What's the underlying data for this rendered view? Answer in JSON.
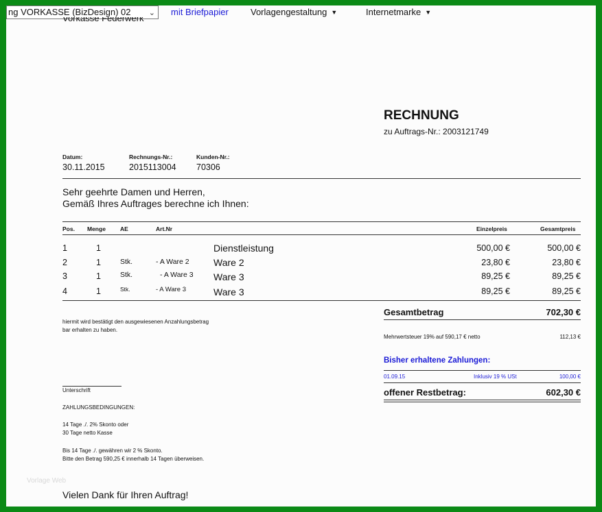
{
  "toolbar": {
    "template_select": "ng VORKASSE (BizDesign) 02",
    "letterhead_link": "mit Briefpapier",
    "menu_design": "Vorlagengestaltung",
    "menu_stamp": "Internetmarke"
  },
  "document": {
    "cut_off_header": "Vorkasse Federwerk",
    "title": "RECHNUNG",
    "order_line": "zu Auftrags-Nr.: 2003121749",
    "meta": {
      "date_label": "Datum:",
      "date_value": "30.11.2015",
      "invoice_label": "Rechnungs-Nr.:",
      "invoice_value": "2015113004",
      "customer_label": "Kunden-Nr.:",
      "customer_value": "70306"
    },
    "greeting_1": "Sehr geehrte Damen und Herren,",
    "greeting_2": "Gemäß Ihres Auftrages berechne ich Ihnen:",
    "table": {
      "headers": {
        "pos": "Pos.",
        "menge": "Menge",
        "ae": "AE",
        "artnr": "Art.Nr",
        "einzel": "Einzelpreis",
        "gesamt": "Gesamtpreis"
      },
      "rows": [
        {
          "pos": "1",
          "menge": "1",
          "ae": "",
          "artnr": "",
          "desc": "Dienstleistung",
          "einzel": "500,00 €",
          "gesamt": "500,00 €"
        },
        {
          "pos": "2",
          "menge": "1",
          "ae": "Stk.",
          "artnr": "- A Ware 2",
          "desc": "Ware 2",
          "einzel": "23,80 €",
          "gesamt": "23,80 €"
        },
        {
          "pos": "3",
          "menge": "1",
          "ae": "Stk.",
          "artnr": "- A Ware 3",
          "desc": "Ware 3",
          "einzel": "89,25 €",
          "gesamt": "89,25 €"
        },
        {
          "pos": "4",
          "menge": "1",
          "ae": "Stk.",
          "artnr": "- A Ware 3",
          "desc": "Ware 3",
          "einzel": "89,25 €",
          "gesamt": "89,25 €"
        }
      ]
    },
    "confirm_1": "hiermit wird bestätigt den ausgewiesenen Anzahlungsbetrag",
    "confirm_2": "bar erhalten zu haben.",
    "total_label": "Gesamtbetrag",
    "total_value": "702,30 €",
    "vat_label": "Mehrwertsteuer 19% auf 590,17 € netto",
    "vat_value": "112,13 €",
    "payments_label": "Bisher erhaltene Zahlungen:",
    "payment_date": "01.09.15",
    "payment_note": "Inklusiv 19 % USt",
    "payment_value": "100,00 €",
    "remaining_label": "offener Restbetrag:",
    "remaining_value": "602,30 €",
    "signature": "Unterschrift",
    "terms_title": "ZAHLUNGSBEDINGUNGEN:",
    "terms_1": "14 Tage ./. 2% Skonto oder",
    "terms_2": "30 Tage netto Kasse",
    "terms_3": "Bis 14 Tage ./. gewähren wir 2 % Skonto.",
    "terms_4": "Bitte den Betrag 590,25 € innerhalb 14 Tagen überweisen.",
    "watermark": "Vorlage Web",
    "thanks": "Vielen Dank für Ihren Auftrag!"
  },
  "colors": {
    "frame": "#0b8a16",
    "link": "#1a1ad6"
  }
}
